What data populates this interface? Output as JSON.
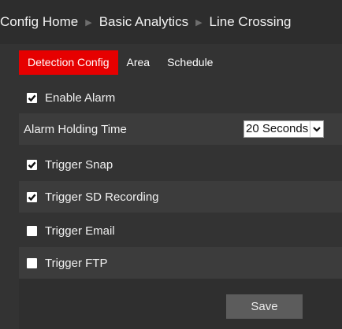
{
  "breadcrumb": [
    "Config Home",
    "Basic Analytics",
    "Line Crossing"
  ],
  "tabs": [
    {
      "label": "Detection Config",
      "active": true
    },
    {
      "label": "Area",
      "active": false
    },
    {
      "label": "Schedule",
      "active": false
    }
  ],
  "form": {
    "enable_alarm": {
      "label": "Enable Alarm",
      "checked": true
    },
    "alarm_holding_time": {
      "label": "Alarm Holding Time",
      "value": "20 Seconds"
    },
    "trigger_snap": {
      "label": "Trigger Snap",
      "checked": true
    },
    "trigger_sd_recording": {
      "label": "Trigger SD Recording",
      "checked": true
    },
    "trigger_email": {
      "label": "Trigger Email",
      "checked": false
    },
    "trigger_ftp": {
      "label": "Trigger FTP",
      "checked": false
    }
  },
  "save_label": "Save",
  "colors": {
    "background": "#333333",
    "header_background": "#2d2d2d",
    "active_tab": "#e60000",
    "row_alt": "#3c3c3c",
    "button": "#5c5c5c"
  },
  "icons": [
    "breadcrumb-separator-icon",
    "checkbox-icon",
    "dropdown-arrow-icon"
  ]
}
